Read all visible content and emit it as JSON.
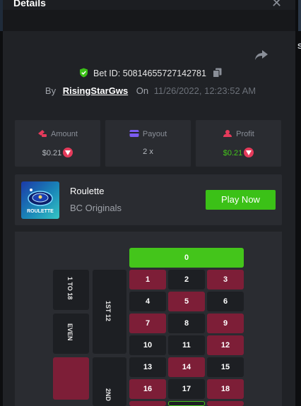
{
  "modal": {
    "title": "Details"
  },
  "edge": {
    "right_letter": "S"
  },
  "bet": {
    "id_label": "Bet ID:",
    "id_value": "50814655727142781",
    "by_label": "By",
    "username": "RisingStarGws",
    "on_label": "On",
    "datetime": "11/26/2022, 12:23:52 AM"
  },
  "stats": [
    {
      "label": "Amount",
      "value": "$0.21",
      "icon": "amount-icon",
      "color": "#b8bcc2",
      "has_coin": true
    },
    {
      "label": "Payout",
      "value": "2 x",
      "icon": "wallet-icon",
      "color": "#b8bcc2",
      "has_coin": false
    },
    {
      "label": "Profit",
      "value": "$0.21",
      "icon": "profit-icon",
      "color": "#44c51b",
      "has_coin": true
    }
  ],
  "game": {
    "name": "Roulette",
    "provider": "BC Originals",
    "thumbnail_text": "ROULETTE",
    "play_label": "Play Now"
  },
  "board": {
    "zero": "0",
    "side_labels": [
      "1 TO 18",
      "EVEN"
    ],
    "dozen_labels": [
      "1ST 12",
      "2ND"
    ],
    "rows": [
      [
        {
          "n": "1",
          "c": "red"
        },
        {
          "n": "2",
          "c": "black"
        },
        {
          "n": "3",
          "c": "red"
        }
      ],
      [
        {
          "n": "4",
          "c": "black"
        },
        {
          "n": "5",
          "c": "red"
        },
        {
          "n": "6",
          "c": "black"
        }
      ],
      [
        {
          "n": "7",
          "c": "red"
        },
        {
          "n": "8",
          "c": "black"
        },
        {
          "n": "9",
          "c": "red"
        }
      ],
      [
        {
          "n": "10",
          "c": "black"
        },
        {
          "n": "11",
          "c": "black"
        },
        {
          "n": "12",
          "c": "red"
        }
      ],
      [
        {
          "n": "13",
          "c": "black"
        },
        {
          "n": "14",
          "c": "red"
        },
        {
          "n": "15",
          "c": "black"
        }
      ],
      [
        {
          "n": "16",
          "c": "red"
        },
        {
          "n": "17",
          "c": "black"
        },
        {
          "n": "18",
          "c": "red"
        }
      ]
    ]
  },
  "colors": {
    "accent_green": "#3bc117",
    "red_cell": "#7d1e37",
    "black_cell": "#1d1f23",
    "panel": "#202226",
    "card": "#2a2c31"
  }
}
